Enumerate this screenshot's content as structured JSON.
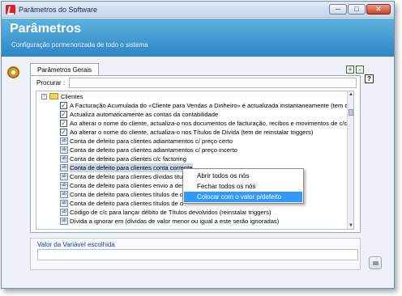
{
  "window": {
    "title": "Parâmetros do Software",
    "controls": {
      "minimize": "─",
      "maximize": "□",
      "close": "✕"
    }
  },
  "header": {
    "title": "Parâmetros",
    "subtitle": "Configuração pormenorizada de todo o sistema"
  },
  "help_label": "?",
  "tabs": [
    {
      "label": "Parâmetros Gerais"
    }
  ],
  "tab_buttons": {
    "add": "+",
    "remove": "-"
  },
  "search": {
    "label": "Procurar :",
    "value": ""
  },
  "tree": {
    "folder": {
      "label": "Clientes",
      "expander": "-"
    },
    "items": [
      {
        "kind": "check",
        "checked": true,
        "label": "A Facturação Acumulada do «Cliente para Vendas a Dinheiro» é actualizada instantaneamente (tem de"
      },
      {
        "kind": "check",
        "checked": true,
        "label": "Actualiza automaticamente as contas da contabilidade"
      },
      {
        "kind": "check",
        "checked": true,
        "label": "Ao alterar o nome do cliente, actualiza-o nos documentos de facturação, recibos e movimentos de c/c"
      },
      {
        "kind": "check",
        "checked": true,
        "label": "Ao alterar o nome do cliente, actualiza-o nos Títulos de Dívida (tem de reinstalar triggers)"
      },
      {
        "kind": "text",
        "label": "Conta de defeito para clientes adiantamentos c/ preço certo"
      },
      {
        "kind": "text",
        "label": "Conta de defeito para clientes adiantamentos c/ preço incerto"
      },
      {
        "kind": "text",
        "label": "Conta de defeito para clientes c/c factoring"
      },
      {
        "kind": "text",
        "label": "Conta de defeito para clientes conta corrente",
        "selected": true
      },
      {
        "kind": "text",
        "label": "Conta de defeito para clientes dívidas titu"
      },
      {
        "kind": "text",
        "label": "Conta de defeito para clientes envio a des"
      },
      {
        "kind": "text",
        "label": "Conta de defeito para clientes títulos de d"
      },
      {
        "kind": "text",
        "label": "Conta de defeito para clientes títulos de d"
      },
      {
        "kind": "text",
        "label": "Código de c/c para lançar débito de Títulos devolvidos (reinstalar triggers)"
      },
      {
        "kind": "text",
        "label": "Dívida a ignorar em   (dívidas de valor menor ou igual a este serão ignoradas)"
      }
    ]
  },
  "context_menu": {
    "items": [
      {
        "label": "Abrir todos os nós",
        "highlighted": false
      },
      {
        "label": "Fechar todos os nós",
        "highlighted": false
      },
      {
        "label": "Colocar com o valor p/defeito",
        "highlighted": true
      }
    ]
  },
  "value_panel": {
    "title": "Valor da Variável escolhida",
    "value": ""
  },
  "colors": {
    "header_top": "#5db3e0",
    "header_bottom": "#2e86c4",
    "menu_highlight": "#3399ff",
    "group_title": "#1a3ea8"
  }
}
